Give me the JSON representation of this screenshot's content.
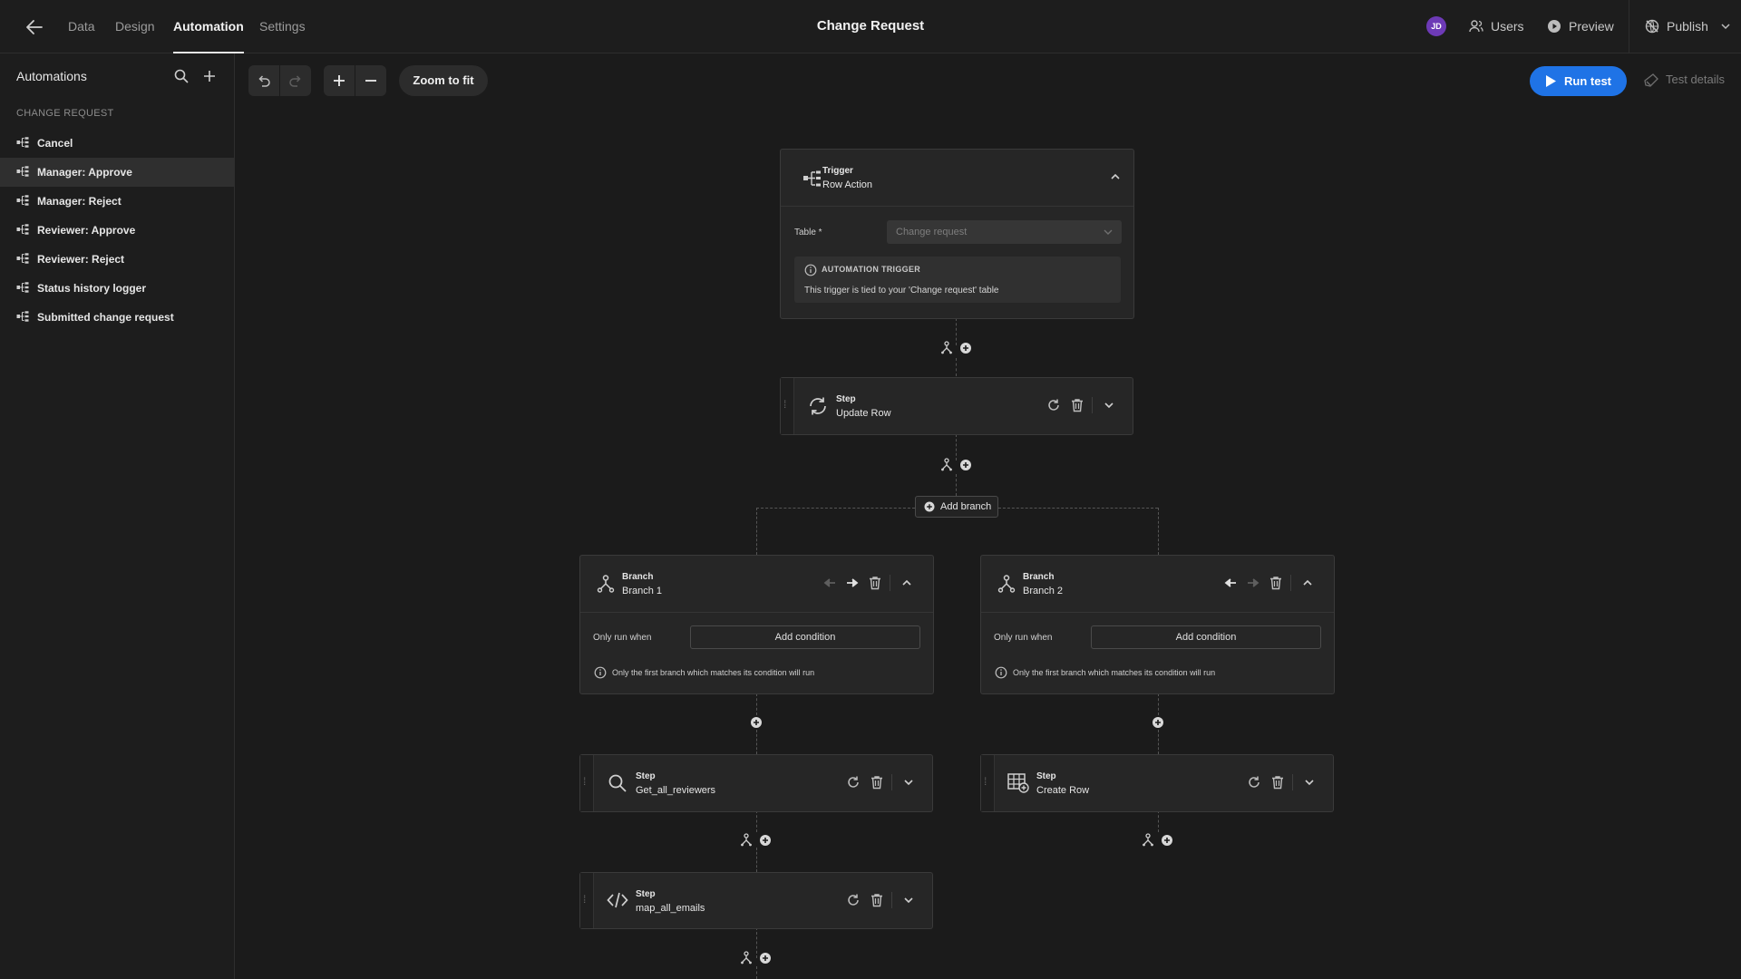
{
  "header": {
    "tabs": [
      {
        "label": "Data"
      },
      {
        "label": "Design"
      },
      {
        "label": "Automation"
      },
      {
        "label": "Settings"
      }
    ],
    "active_tab": "Automation",
    "title": "Change Request",
    "avatar_initials": "JD",
    "users_label": "Users",
    "preview_label": "Preview",
    "publish_label": "Publish"
  },
  "sidebar": {
    "title": "Automations",
    "section": "CHANGE REQUEST",
    "items": [
      {
        "label": "Cancel"
      },
      {
        "label": "Manager: Approve"
      },
      {
        "label": "Manager: Reject"
      },
      {
        "label": "Reviewer: Approve"
      },
      {
        "label": "Reviewer: Reject"
      },
      {
        "label": "Status history logger"
      },
      {
        "label": "Submitted change request"
      }
    ],
    "active_item": "Manager: Approve"
  },
  "toolbar": {
    "zoom_fit_label": "Zoom to fit",
    "run_test_label": "Run test",
    "test_details_label": "Test details"
  },
  "flow": {
    "trigger": {
      "kind": "Trigger",
      "name": "Row Action",
      "table_label": "Table *",
      "table_value": "Change request",
      "info_title": "AUTOMATION TRIGGER",
      "info_text": "This trigger is tied to your 'Change request' table"
    },
    "step_update": {
      "kind": "Step",
      "name": "Update Row"
    },
    "add_branch_label": "Add branch",
    "branches": [
      {
        "kind": "Branch",
        "name": "Branch 1",
        "only_run_when": "Only run when",
        "add_condition": "Add condition",
        "note": "Only the first branch which matches its condition will run",
        "steps": [
          {
            "kind": "Step",
            "name": "Get_all_reviewers"
          },
          {
            "kind": "Step",
            "name": "map_all_emails"
          }
        ]
      },
      {
        "kind": "Branch",
        "name": "Branch 2",
        "only_run_when": "Only run when",
        "add_condition": "Add condition",
        "note": "Only the first branch which matches its condition will run",
        "steps": [
          {
            "kind": "Step",
            "name": "Create Row"
          }
        ]
      }
    ]
  },
  "colors": {
    "background": "#1b1b1b",
    "accent": "#1f73e6",
    "avatar": "#6d3ab6",
    "card": "#262626"
  },
  "icons": {
    "back": "arrow-left-icon",
    "users": "users-icon",
    "preview": "play-circle-icon",
    "publish": "globe-off-icon",
    "search": "search-icon",
    "add": "plus-icon",
    "automation": "flow-icon",
    "undo": "undo-icon",
    "redo": "redo-icon",
    "zoom_in": "plus-icon",
    "zoom_out": "minus-icon",
    "run": "play-icon",
    "test_details": "flask-icon"
  }
}
